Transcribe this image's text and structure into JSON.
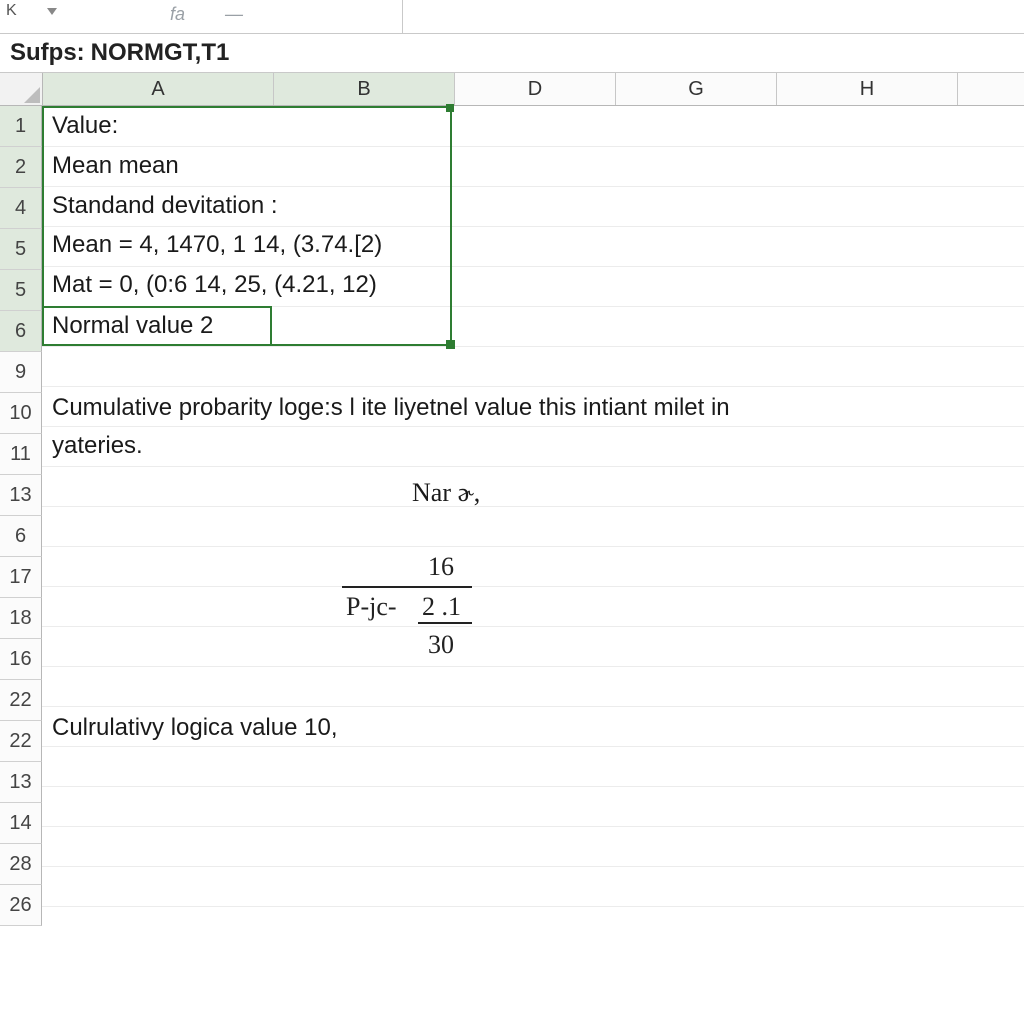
{
  "toolbar": {
    "namebox_letter": "K",
    "faint1": "fa",
    "faint2": "—"
  },
  "formula_bar": {
    "label": "Sufps:",
    "value": "NORMGT,T1"
  },
  "columns": [
    "A",
    "B",
    "D",
    "G",
    "H"
  ],
  "row_headers": [
    "1",
    "2",
    "4",
    "5",
    "5",
    "6",
    "9",
    "10",
    "11",
    "13",
    "6",
    "17",
    "18",
    "16",
    "22",
    "22",
    "13",
    "14",
    "28",
    "26"
  ],
  "cells": {
    "r1": "Value:",
    "r2": "Mean mean",
    "r3": "Standand devitation :",
    "r4": "Mean = 4, 1470, 1 14, (3.74.[2)",
    "r5": "Mat = 0, (0:6 14, 25, (4.21, 12)",
    "r6": "Normal value 2",
    "r8": "Cumulative probarity loge:s l ite liyetnel value this intiant milet in",
    "r9": "yateries.",
    "nar": "Nar ɚ,",
    "frac_top": "16",
    "frac_prefix": "P-jc-",
    "frac_mid": "2 .1",
    "frac_bot": "30",
    "r16": "Culrulativy logica value 10,"
  }
}
